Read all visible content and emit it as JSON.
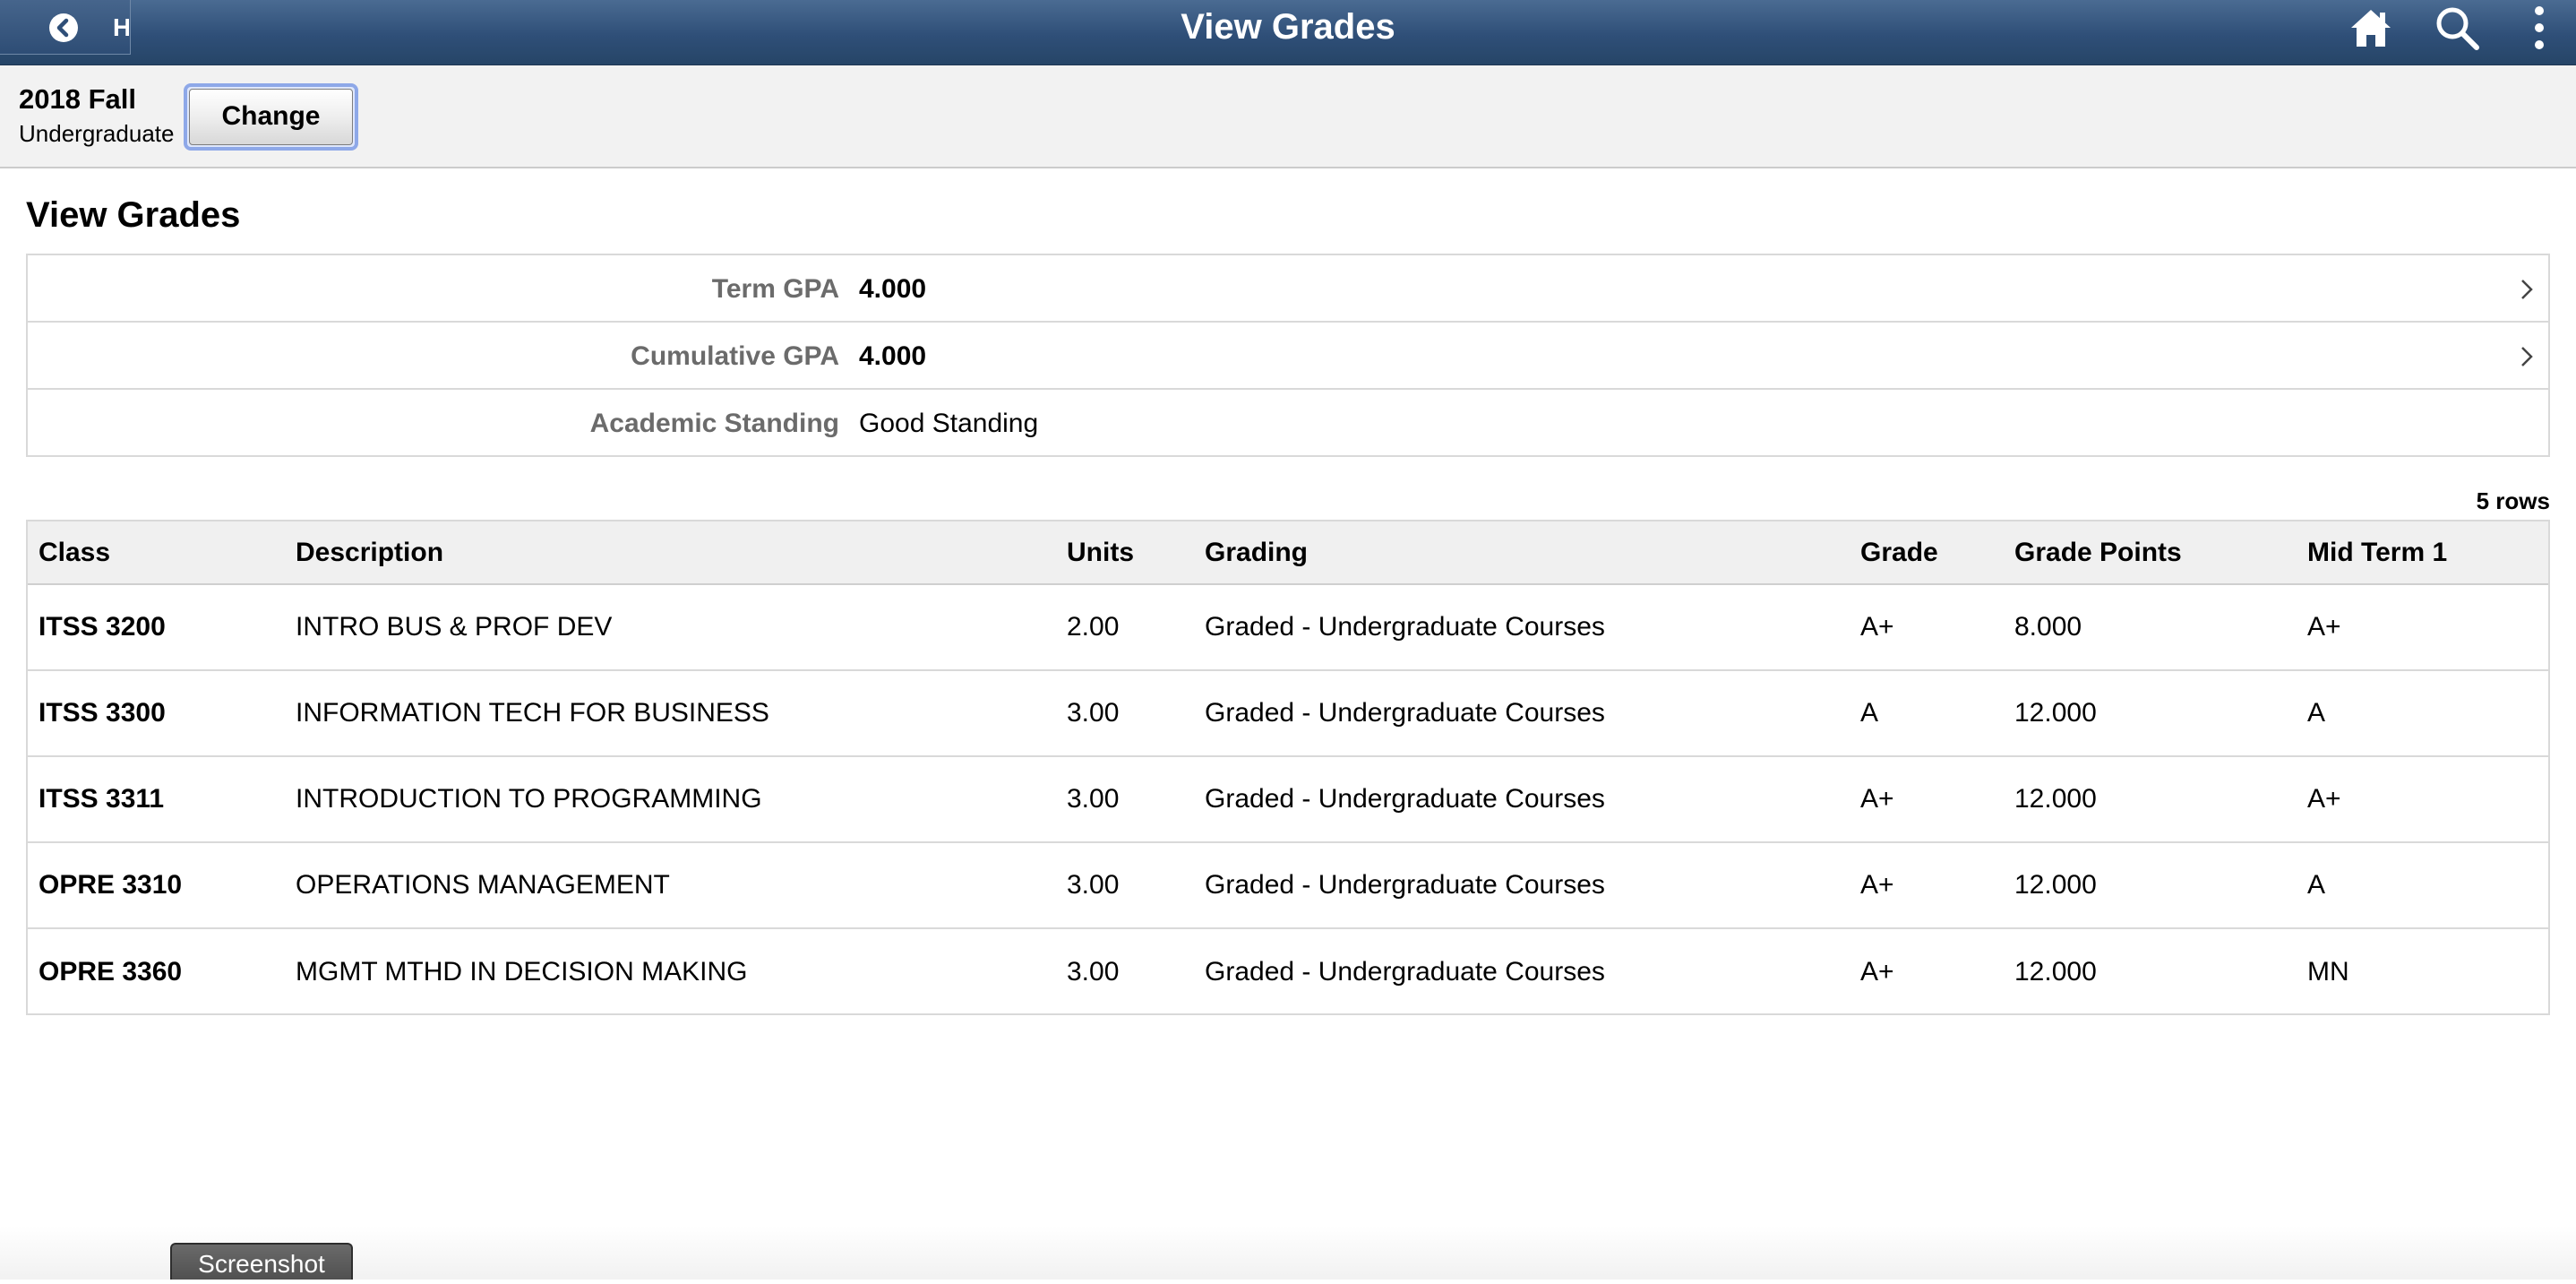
{
  "header": {
    "back_label": "H",
    "title": "View Grades",
    "icons": {
      "back": "back-arrow-icon",
      "home": "home-icon",
      "search": "search-icon",
      "menu": "more-vertical-icon"
    }
  },
  "term": {
    "name": "2018 Fall",
    "career": "Undergraduate",
    "change_label": "Change"
  },
  "page": {
    "title": "View Grades"
  },
  "summary": [
    {
      "label": "Term GPA",
      "value": "4.000",
      "has_chevron": true
    },
    {
      "label": "Cumulative GPA",
      "value": "4.000",
      "has_chevron": true
    },
    {
      "label": "Academic Standing",
      "value": "Good Standing",
      "has_chevron": false
    }
  ],
  "grid": {
    "rows_count": "5 rows",
    "columns": [
      "Class",
      "Description",
      "Units",
      "Grading",
      "Grade",
      "Grade Points",
      "Mid Term 1"
    ],
    "rows": [
      [
        "ITSS 3200",
        "INTRO BUS & PROF DEV",
        "2.00",
        "Graded - Undergraduate Courses",
        "A+",
        "8.000",
        "A+"
      ],
      [
        "ITSS 3300",
        "INFORMATION TECH FOR BUSINESS",
        "3.00",
        "Graded - Undergraduate Courses",
        "A",
        "12.000",
        "A"
      ],
      [
        "ITSS 3311",
        "INTRODUCTION TO PROGRAMMING",
        "3.00",
        "Graded - Undergraduate Courses",
        "A+",
        "12.000",
        "A+"
      ],
      [
        "OPRE 3310",
        "OPERATIONS MANAGEMENT",
        "3.00",
        "Graded - Undergraduate Courses",
        "A+",
        "12.000",
        "A"
      ],
      [
        "OPRE 3360",
        "MGMT MTHD IN DECISION MAKING",
        "3.00",
        "Graded - Undergraduate Courses",
        "A+",
        "12.000",
        "MN"
      ]
    ]
  },
  "footer": {
    "screenshot_label": "Screenshot"
  },
  "colors": {
    "header_top": "#4a6b92",
    "header_bottom": "#264567",
    "term_bar_bg": "#f2f2f2",
    "label_gray": "#6b6b6b",
    "focus_ring": "#8ea8e8"
  }
}
